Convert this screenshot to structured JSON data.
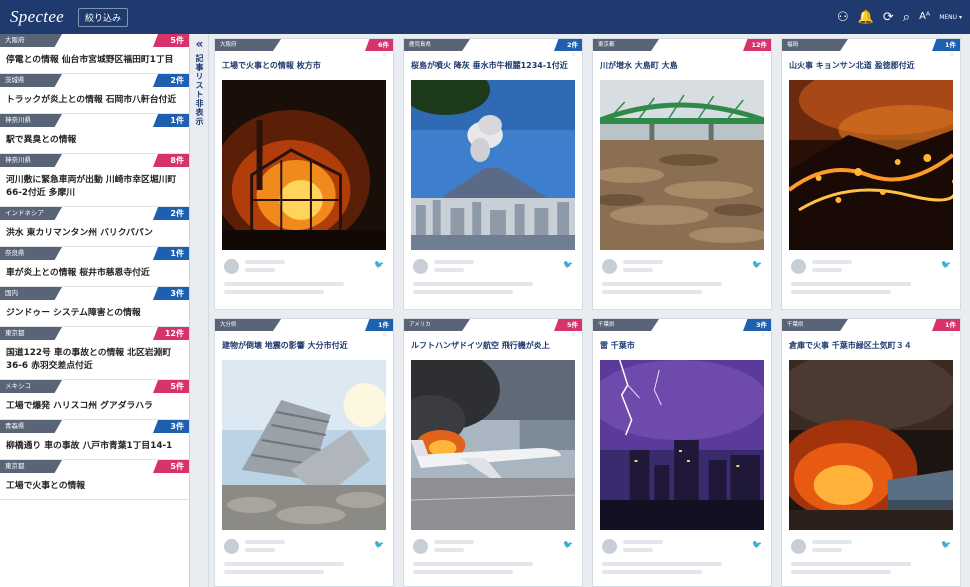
{
  "app": {
    "logo": "Spectee",
    "filter_label": "絞り込み"
  },
  "top_icons": [
    {
      "name": "people-icon",
      "glyph": "⚇"
    },
    {
      "name": "bell-icon",
      "glyph": "🔔"
    },
    {
      "name": "refresh-icon",
      "glyph": "⟳"
    },
    {
      "name": "search-icon",
      "glyph": "⌕"
    },
    {
      "name": "font-size-icon",
      "glyph": "Aᴬ"
    },
    {
      "name": "menu-icon",
      "glyph": "MENU ▾"
    }
  ],
  "collapse": {
    "arrow": "«",
    "label": "記事リスト非表示"
  },
  "feed": [
    {
      "region": "大阪府",
      "count": "5",
      "color": "red",
      "title": "停電との情報 仙台市宮城野区福田町1丁目"
    },
    {
      "region": "茨城県",
      "count": "2",
      "color": "blue",
      "title": "トラックが炎上との情報 石岡市八軒台付近"
    },
    {
      "region": "神奈川県",
      "count": "1",
      "color": "blue",
      "title": "駅で異臭との情報"
    },
    {
      "region": "神奈川県",
      "count": "8",
      "color": "red",
      "title": "河川敷に緊急車両が出動 川崎市幸区堀川町66-2付近 多摩川"
    },
    {
      "region": "インドネシア",
      "count": "2",
      "color": "blue",
      "title": "洪水 東カリマンタン州 バリクパパン"
    },
    {
      "region": "奈良県",
      "count": "1",
      "color": "blue",
      "title": "車が炎上との情報 桜井市慈恩寺付近"
    },
    {
      "region": "国内",
      "count": "3",
      "color": "blue",
      "title": "ジンドゥー システム障害との情報"
    },
    {
      "region": "東京都",
      "count": "12",
      "color": "red",
      "title": "国道122号 車の事故との情報 北区岩淵町36-6 赤羽交差点付近"
    },
    {
      "region": "メキシコ",
      "count": "5",
      "color": "red",
      "title": "工場で爆発 ハリスコ州 グアダラハラ"
    },
    {
      "region": "青森県",
      "count": "3",
      "color": "blue",
      "title": "柳橋通り 車の事故 八戸市青葉1丁目14-1"
    },
    {
      "region": "東京都",
      "count": "5",
      "color": "red",
      "title": "工場で火事との情報"
    }
  ],
  "count_suffix": "件",
  "cards": [
    {
      "region": "大阪府",
      "count": "6",
      "color": "red",
      "title": "工場で火事との情報 枚方市",
      "scene": "factory-fire"
    },
    {
      "region": "鹿児島県",
      "count": "2",
      "color": "blue",
      "title": "桜島が噴火 降灰 垂水市牛根麓1234-1付近",
      "scene": "volcano"
    },
    {
      "region": "東京都",
      "count": "12",
      "color": "red",
      "title": "川が増水 大島町 大島",
      "scene": "flood"
    },
    {
      "region": "福岡",
      "count": "1",
      "color": "blue",
      "title": "山火事 キョンサン北道 盈徳郡付近",
      "scene": "wildfire"
    },
    {
      "region": "大分県",
      "count": "1",
      "color": "blue",
      "title": "建物が倒壊 地震の影響 大分市付近",
      "scene": "collapse"
    },
    {
      "region": "アメリカ",
      "count": "5",
      "color": "red",
      "title": "ルフトハンザドイツ航空 飛行機が炎上",
      "scene": "plane-fire"
    },
    {
      "region": "千葉県",
      "count": "3",
      "color": "blue",
      "title": "雷 千葉市",
      "scene": "lightning"
    },
    {
      "region": "千葉県",
      "count": "1",
      "color": "red",
      "title": "倉庫で火事 千葉市緑区土気町３４",
      "scene": "warehouse-fire"
    }
  ],
  "colors": {
    "header": "#1f3a6e",
    "red": "#d6336c",
    "blue": "#1e5fb0",
    "region": "#596577"
  }
}
